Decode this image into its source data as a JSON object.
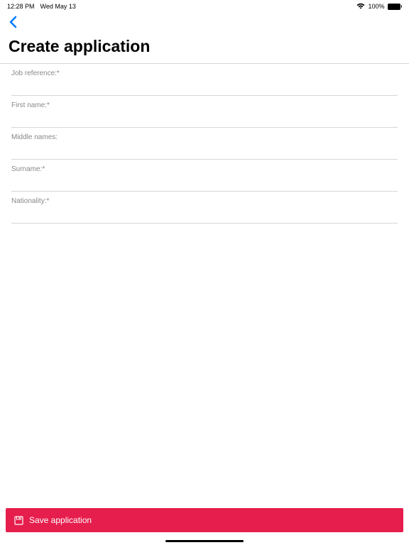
{
  "statusBar": {
    "time": "12:28 PM",
    "date": "Wed May 13",
    "batteryPercent": "100%"
  },
  "page": {
    "title": "Create application"
  },
  "form": {
    "fields": [
      {
        "label": "Job reference:*",
        "value": ""
      },
      {
        "label": "First name:*",
        "value": ""
      },
      {
        "label": "Middle names:",
        "value": ""
      },
      {
        "label": "Surname:*",
        "value": ""
      },
      {
        "label": "Nationality:*",
        "value": ""
      }
    ]
  },
  "actions": {
    "saveLabel": "Save application"
  }
}
